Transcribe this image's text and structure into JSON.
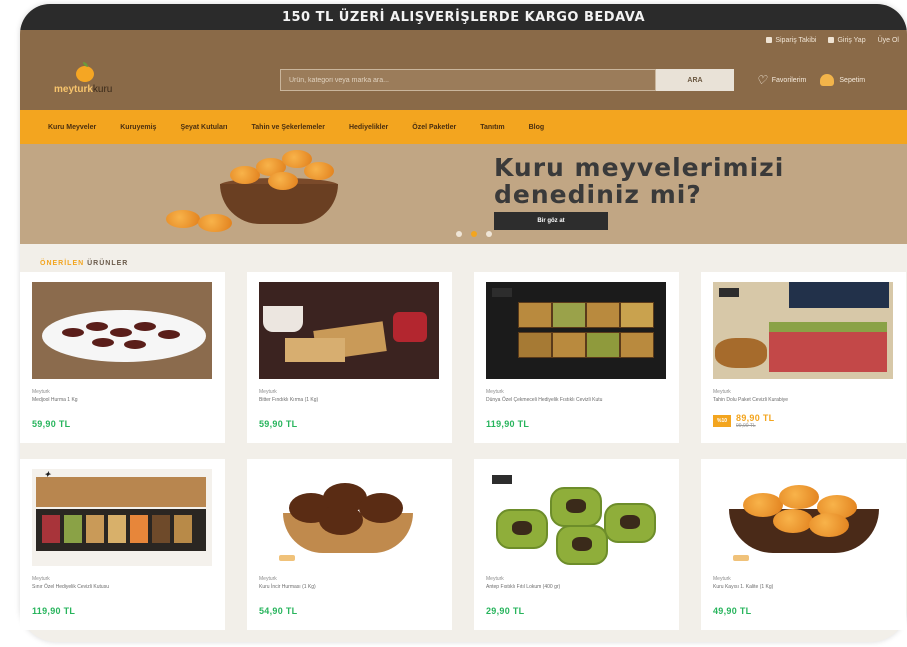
{
  "promo_bar": {
    "text": "150 TL ÜZERİ ALIŞVERİŞLERDE KARGO BEDAVA"
  },
  "top_links": [
    {
      "label": "Sipariş Takibi"
    },
    {
      "label": "Giriş Yap"
    },
    {
      "label": "Üye Ol"
    }
  ],
  "logo": {
    "main": "meyturk",
    "sub": "kuru"
  },
  "search": {
    "placeholder": "Ürün, kategori veya marka ara...",
    "button": "ARA"
  },
  "header_actions": {
    "favorites": "Favorilerim",
    "cart": "Sepetim"
  },
  "nav": [
    "Kuru Meyveler",
    "Kuruyemiş",
    "Şeyat Kutuları",
    "Tahin ve Şekerlemeler",
    "Hediyelikler",
    "Özel Paketler",
    "Tanıtım",
    "Blog"
  ],
  "hero": {
    "line1": "Kuru meyvelerimizi",
    "line2": "denediniz mi?",
    "button": "Bir göz at"
  },
  "section": {
    "accent": "ÖNERİLEN",
    "title": "ÜRÜNLER"
  },
  "products": [
    {
      "brand": "Meyturk",
      "name": "Medjool Hurma 1 Kg",
      "price": "59,90 TL"
    },
    {
      "brand": "Meyturk",
      "name": "Bitter Fındıklı Kırma (1 Kg)",
      "price": "59,90 TL"
    },
    {
      "brand": "Meyturk",
      "name": "Dünya Özel Çekmeceli Hediyelik Fıstıklı Cevizli Kutu",
      "price": "119,90 TL"
    },
    {
      "brand": "Meyturk",
      "name": "Tahin Dolu Paket Cevizli Kurabiye",
      "discount": "%10",
      "old_price": "99,90 TL",
      "price": "89,90 TL"
    },
    {
      "brand": "Meyturk",
      "name": "Sınır Özel Hediyelik Cevizli Kutusu",
      "price": "119,90 TL"
    },
    {
      "brand": "Meyturk",
      "name": "Kuru İncir Hurması (1 Kg)",
      "price": "54,90 TL"
    },
    {
      "brand": "Meyturk",
      "name": "Antep Fıstıklı Fıtıl Lokum (400 gr)",
      "price": "29,90 TL"
    },
    {
      "brand": "Meyturk",
      "name": "Kuru Kayısı 1. Kalite (1 Kg)",
      "price": "49,90 TL"
    }
  ],
  "colors": {
    "header_brown": "#8a6a48",
    "nav_orange": "#f3a51f",
    "price_green": "#27b45c",
    "hero_bg": "#c1a684",
    "promo_dark": "#2b2b2b"
  },
  "icons": [
    "truck-icon",
    "user-icon",
    "heart-icon",
    "cart-icon"
  ]
}
